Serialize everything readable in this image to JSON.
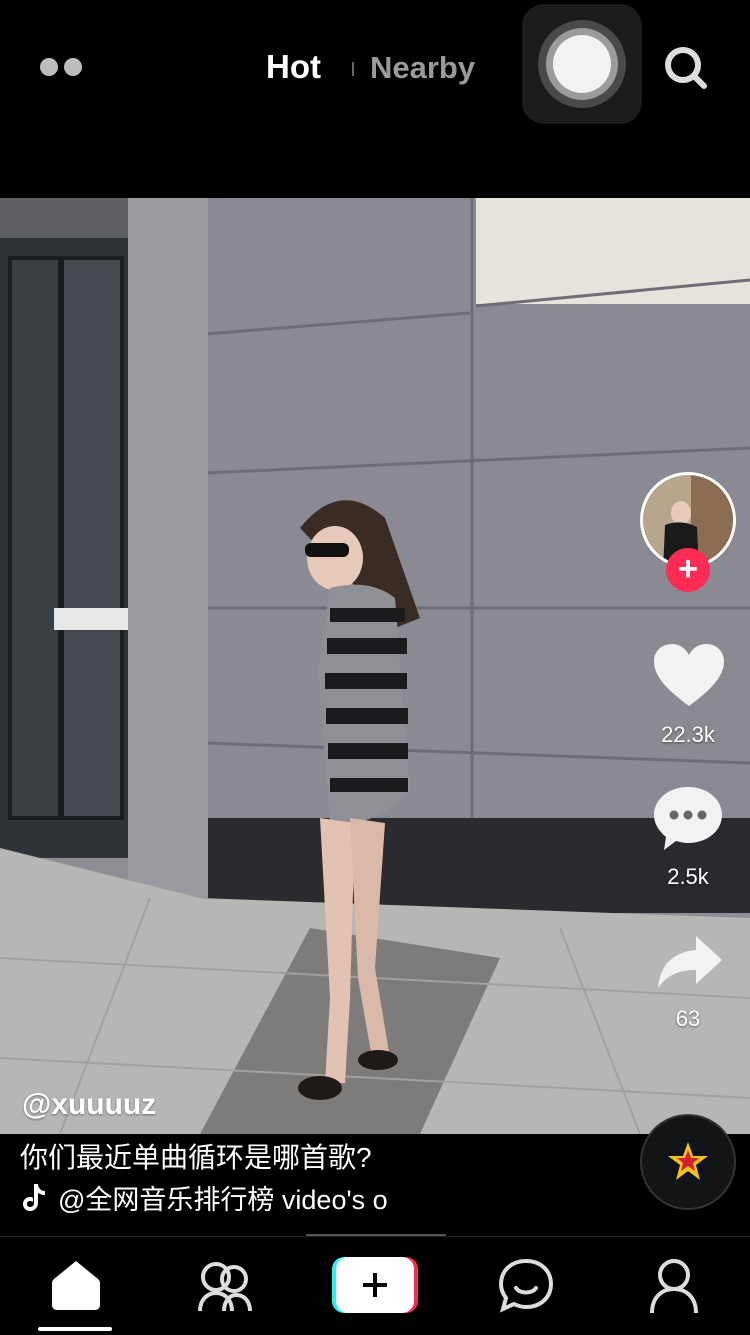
{
  "header": {
    "tabs": [
      {
        "label": "Hot",
        "active": true
      },
      {
        "label": "Nearby",
        "active": false
      }
    ],
    "icons": [
      "dots-menu-icon",
      "assistive-touch-icon",
      "search-icon"
    ]
  },
  "video": {
    "author": "@xuuuuz",
    "caption": "你们最近单曲循环是哪首歌?",
    "music": "@全网音乐排行榜 video's o"
  },
  "actions": {
    "likes": "22.3k",
    "comments": "2.5k",
    "shares": "63"
  },
  "colors": {
    "accent": "#fe2c55",
    "cyan": "#25f4ee",
    "background": "#000000"
  },
  "tabbar": {
    "items": [
      "home-icon",
      "friends-icon",
      "create-icon",
      "messages-icon",
      "profile-icon"
    ]
  }
}
